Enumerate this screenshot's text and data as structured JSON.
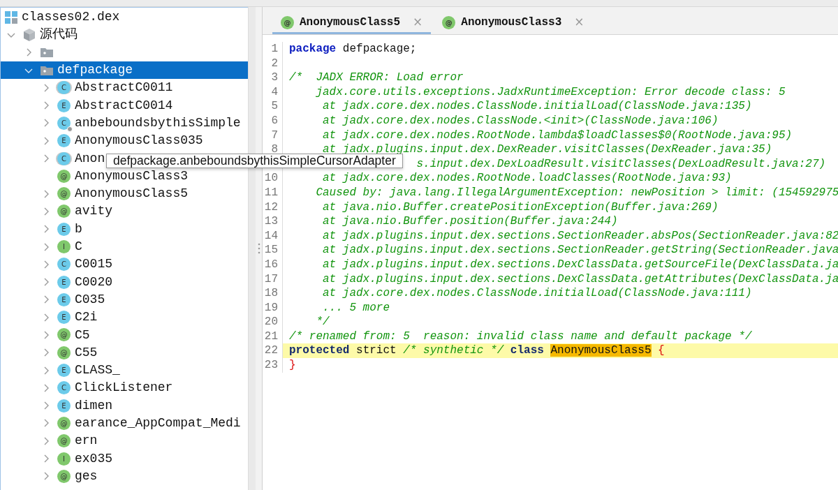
{
  "tree": [
    {
      "label": "classes02.dex",
      "kind": "dex",
      "selected": false,
      "children": [
        {
          "label": "源代码",
          "kind": "source",
          "expanded": true,
          "selected": false,
          "children": [
            {
              "kind": "folder",
              "expanded": false,
              "selected": false
            },
            {
              "label": "defpackage",
              "kind": "folder",
              "expanded": true,
              "selected": true,
              "children": [
                {
                  "label": "AbstractC0011",
                  "kind": "abstract",
                  "badge": "C",
                  "expandable": true
                },
                {
                  "label": "AbstractC0014",
                  "kind": "enum",
                  "badge": "E",
                  "expandable": true
                },
                {
                  "label": "anbeboundsbythisSimple",
                  "kind": "inner",
                  "badge": "C",
                  "expandable": true
                },
                {
                  "label": "AnonymousClass035",
                  "kind": "enum",
                  "badge": "E",
                  "expandable": true
                },
                {
                  "label": "Anon",
                  "kind": "abstract",
                  "badge": "C",
                  "expandable": true
                },
                {
                  "label": "AnonymousClass3",
                  "kind": "annotation",
                  "badge": "@",
                  "expandable": false
                },
                {
                  "label": "AnonymousClass5",
                  "kind": "annotation",
                  "badge": "@",
                  "expandable": true
                },
                {
                  "label": "avity",
                  "kind": "annotation",
                  "badge": "@",
                  "expandable": true
                },
                {
                  "label": "b",
                  "kind": "enum",
                  "badge": "E",
                  "expandable": true
                },
                {
                  "label": "C",
                  "kind": "interface",
                  "badge": "I",
                  "expandable": true
                },
                {
                  "label": "C0015",
                  "kind": "class",
                  "badge": "C",
                  "expandable": true
                },
                {
                  "label": "C0020",
                  "kind": "enum",
                  "badge": "E",
                  "expandable": true
                },
                {
                  "label": "C035",
                  "kind": "enum",
                  "badge": "E",
                  "expandable": true
                },
                {
                  "label": "C2i",
                  "kind": "enum",
                  "badge": "E",
                  "expandable": true
                },
                {
                  "label": "C5",
                  "kind": "annotation",
                  "badge": "@",
                  "expandable": true
                },
                {
                  "label": "C55",
                  "kind": "annotation",
                  "badge": "@",
                  "expandable": true
                },
                {
                  "label": "CLASS_",
                  "kind": "enum",
                  "badge": "E",
                  "expandable": true
                },
                {
                  "label": "ClickListener",
                  "kind": "class",
                  "badge": "C",
                  "expandable": true
                },
                {
                  "label": "dimen",
                  "kind": "enum",
                  "badge": "E",
                  "expandable": true
                },
                {
                  "label": "earance_AppCompat_Medi",
                  "kind": "annotation",
                  "badge": "@",
                  "expandable": true
                },
                {
                  "label": "ern",
                  "kind": "annotation",
                  "badge": "@",
                  "expandable": true
                },
                {
                  "label": "ex035",
                  "kind": "interface",
                  "badge": "I",
                  "expandable": true
                },
                {
                  "label": "ges",
                  "kind": "annotation",
                  "badge": "@",
                  "expandable": true
                }
              ]
            }
          ]
        }
      ]
    }
  ],
  "tooltip": "defpackage.anbeboundsbythisSimpleCursorAdapter",
  "tabs": [
    {
      "label": "AnonymousClass5",
      "badge": "@",
      "close": "×",
      "selected": true
    },
    {
      "label": "AnonymousClass3",
      "badge": "@",
      "close": "×",
      "selected": false
    }
  ],
  "code": [
    {
      "number": "1",
      "highlighted": false,
      "tokens": [
        {
          "kind": "keyword",
          "text": "package"
        },
        {
          "kind": "plain",
          "text": " defpackage;"
        }
      ]
    },
    {
      "number": "2",
      "highlighted": false
    },
    {
      "number": "3",
      "highlighted": false,
      "tokens": [
        {
          "kind": "comment",
          "text": "/*  JADX ERROR: Load error"
        }
      ]
    },
    {
      "number": "4",
      "highlighted": false,
      "tokens": [
        {
          "kind": "comment",
          "text": "    jadx.core.utils.exceptions.JadxRuntimeException: Error decode class: 5"
        }
      ]
    },
    {
      "number": "5",
      "highlighted": false,
      "tokens": [
        {
          "kind": "comment",
          "text": "     at jadx.core.dex.nodes.ClassNode.initialLoad(ClassNode.java:135)"
        }
      ]
    },
    {
      "number": "6",
      "highlighted": false,
      "tokens": [
        {
          "kind": "comment",
          "text": "     at jadx.core.dex.nodes.ClassNode.<init>(ClassNode.java:106)"
        }
      ]
    },
    {
      "number": "7",
      "highlighted": false,
      "tokens": [
        {
          "kind": "comment",
          "text": "     at jadx.core.dex.nodes.RootNode.lambda$loadClasses$0(RootNode.java:95)"
        }
      ]
    },
    {
      "number": "8",
      "highlighted": false,
      "tokens": [
        {
          "kind": "comment",
          "text": "     at jadx.plugins.input.dex.DexReader.visitClasses(DexReader.java:35)"
        }
      ]
    },
    {
      "highlighted": false,
      "tokens": [
        {
          "kind": "comment",
          "text": "                   s.input.dex.DexLoadResult.visitClasses(DexLoadResult.java:27)"
        }
      ]
    },
    {
      "number": "10",
      "highlighted": false,
      "tokens": [
        {
          "kind": "comment",
          "text": "     at jadx.core.dex.nodes.RootNode.loadClasses(RootNode.java:93)"
        }
      ]
    },
    {
      "number": "11",
      "highlighted": false,
      "tokens": [
        {
          "kind": "comment",
          "text": "    Caused by: java.lang.IllegalArgumentException: newPosition > limit: (154592975"
        }
      ]
    },
    {
      "number": "12",
      "highlighted": false,
      "tokens": [
        {
          "kind": "comment",
          "text": "     at java.nio.Buffer.createPositionException(Buffer.java:269)"
        }
      ]
    },
    {
      "number": "13",
      "highlighted": false,
      "tokens": [
        {
          "kind": "comment",
          "text": "     at java.nio.Buffer.position(Buffer.java:244)"
        }
      ]
    },
    {
      "number": "14",
      "highlighted": false,
      "tokens": [
        {
          "kind": "comment",
          "text": "     at jadx.plugins.input.dex.sections.SectionReader.absPos(SectionReader.java:82"
        }
      ]
    },
    {
      "number": "15",
      "highlighted": false,
      "tokens": [
        {
          "kind": "comment",
          "text": "     at jadx.plugins.input.dex.sections.SectionReader.getString(SectionReader.java"
        }
      ]
    },
    {
      "number": "16",
      "highlighted": false,
      "tokens": [
        {
          "kind": "comment",
          "text": "     at jadx.plugins.input.dex.sections.DexClassData.getSourceFile(DexClassData.ja"
        }
      ]
    },
    {
      "number": "17",
      "highlighted": false,
      "tokens": [
        {
          "kind": "comment",
          "text": "     at jadx.plugins.input.dex.sections.DexClassData.getAttributes(DexClassData.ja"
        }
      ]
    },
    {
      "number": "18",
      "highlighted": false,
      "tokens": [
        {
          "kind": "comment",
          "text": "     at jadx.core.dex.nodes.ClassNode.initialLoad(ClassNode.java:111)"
        }
      ]
    },
    {
      "number": "19",
      "highlighted": false,
      "tokens": [
        {
          "kind": "comment",
          "text": "     ... 5 more"
        }
      ]
    },
    {
      "number": "20",
      "highlighted": false,
      "tokens": [
        {
          "kind": "comment",
          "text": "    */"
        }
      ]
    },
    {
      "number": "21",
      "highlighted": false,
      "tokens": [
        {
          "kind": "comment",
          "text": "/* renamed from: 5  reason: invalid class name and default package */"
        }
      ]
    },
    {
      "number": "22",
      "highlighted": true,
      "tokens": [
        {
          "kind": "keyword",
          "text": "protected"
        },
        {
          "kind": "plain",
          "text": " strict "
        },
        {
          "kind": "comment",
          "text": "/* synthetic */ "
        },
        {
          "kind": "keyword",
          "text": "class "
        },
        {
          "kind": "match",
          "text": "AnonymousClass5"
        },
        {
          "kind": "brace",
          "text": " {"
        }
      ]
    },
    {
      "number": "23",
      "highlighted": false,
      "tokens": [
        {
          "kind": "brace",
          "text": "}"
        }
      ]
    }
  ]
}
